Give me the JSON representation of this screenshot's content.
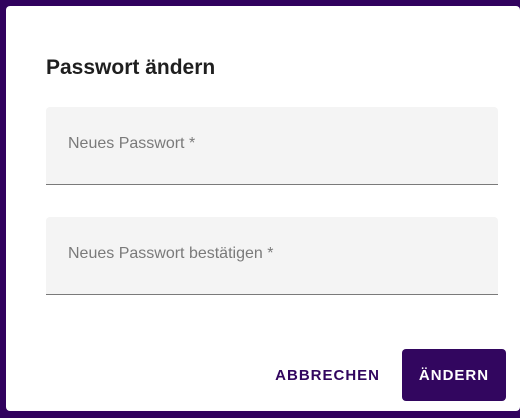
{
  "dialog": {
    "title": "Passwort ändern",
    "fields": [
      {
        "label": "Neues Passwort *"
      },
      {
        "label": "Neues Passwort bestätigen *"
      }
    ],
    "actions": {
      "cancel_label": "ABBRECHEN",
      "confirm_label": "ÄNDERN"
    }
  },
  "colors": {
    "backdrop": "#31025e",
    "primary": "#32065f",
    "field_background": "#f4f4f4"
  }
}
